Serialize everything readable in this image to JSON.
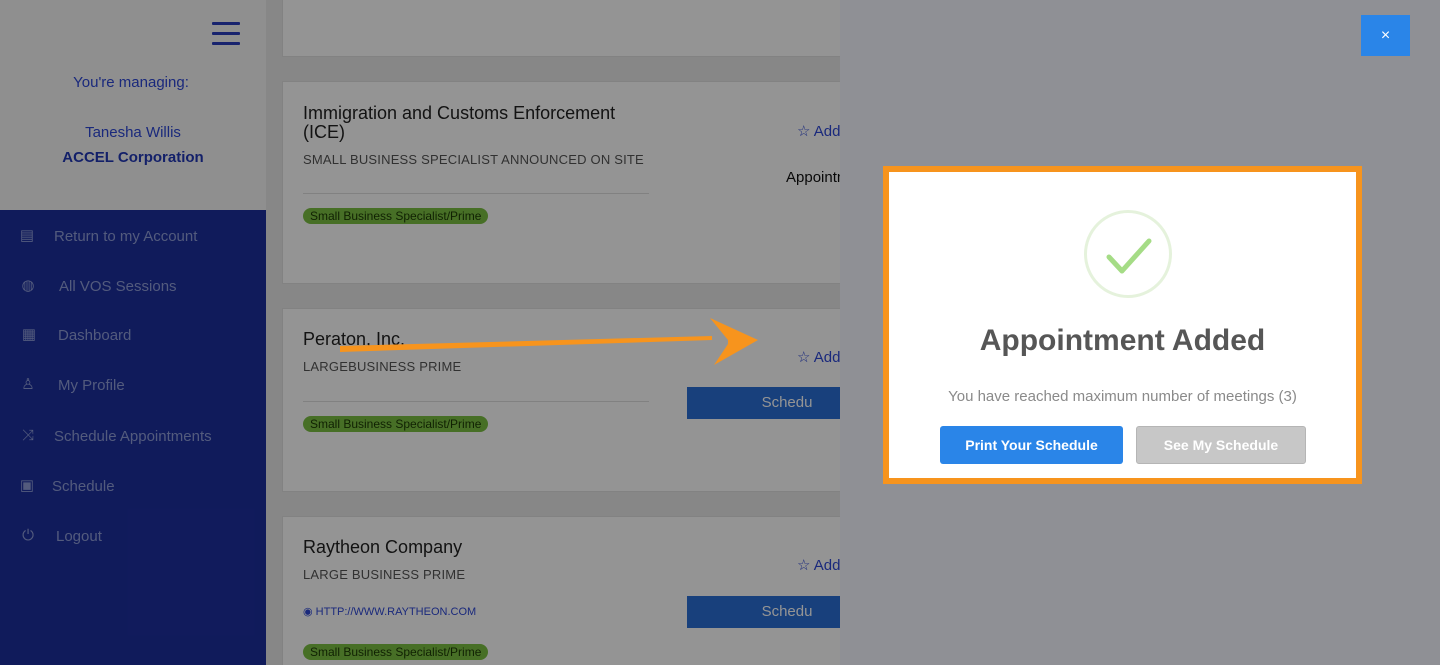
{
  "sidebar": {
    "managing_label": "You're managing:",
    "user_name": "Tanesha Willis",
    "organization": "ACCEL Corporation",
    "items": [
      {
        "label": "Return to my Account",
        "icon": "list-icon"
      },
      {
        "label": "All VOS Sessions",
        "icon": "globe-icon"
      },
      {
        "label": "Dashboard",
        "icon": "layout-icon"
      },
      {
        "label": "My Profile",
        "icon": "user-icon"
      },
      {
        "label": "Schedule Appointments",
        "icon": "shuffle-icon"
      },
      {
        "label": "Schedule",
        "icon": "clipboard-icon"
      },
      {
        "label": "Logout",
        "icon": "power-icon"
      }
    ]
  },
  "cards": [
    {
      "title": "Immigration and Customs Enforcement (ICE)",
      "subtitle": "SMALL BUSINESS SPECIALIST ANNOUNCED ON SITE",
      "badge": "Small Business Specialist/Prime",
      "add_label": "Add",
      "status_text": "Appointm"
    },
    {
      "title": "Peraton, Inc.",
      "subtitle": "LARGEBUSINESS PRIME",
      "badge": "Small Business Specialist/Prime",
      "add_label": "Add",
      "schedule_label": "Schedu"
    },
    {
      "title": "Raytheon Company",
      "subtitle": "LARGE BUSINESS PRIME",
      "link": "HTTP://WWW.RAYTHEON.COM",
      "badge": "Small Business Specialist/Prime",
      "add_label": "Add",
      "schedule_label": "Schedu"
    }
  ],
  "modal": {
    "title": "Appointment Added",
    "message": "You have reached maximum number of meetings (3)",
    "print_button": "Print Your Schedule",
    "see_button": "See My Schedule",
    "close_label": "×"
  },
  "colors": {
    "sidebar": "#1d2f9e",
    "accent": "#2a85e8",
    "highlight": "#f7941d",
    "badge": "#7bc043"
  }
}
